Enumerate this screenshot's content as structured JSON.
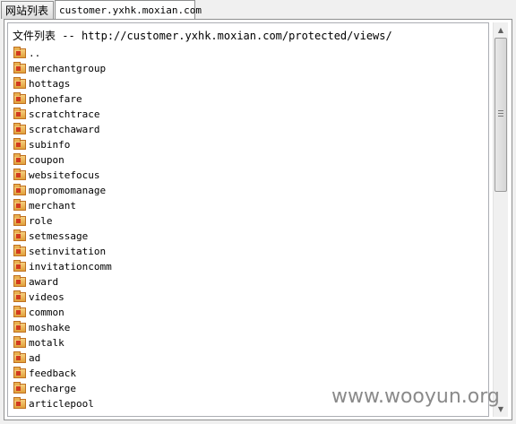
{
  "tabs": [
    {
      "label": "网站列表"
    },
    {
      "label": "customer.yxhk.moxian.com"
    }
  ],
  "header": {
    "label": "文件列表",
    "separator": "--",
    "path": "http://customer.yxhk.moxian.com/protected/views/"
  },
  "folders": [
    "..",
    "merchantgroup",
    "hottags",
    "phonefare",
    "scratchtrace",
    "scratchaward",
    "subinfo",
    "coupon",
    "websitefocus",
    "mopromomanage",
    "merchant",
    "role",
    "setmessage",
    "setinvitation",
    "invitationcomm",
    "award",
    "videos",
    "common",
    "moshake",
    "motalk",
    "ad",
    "feedback",
    "recharge",
    "articlepool"
  ],
  "icons": {
    "folder": "folder-icon",
    "scroll_up": "scroll-up-arrow-icon",
    "scroll_down": "scroll-down-arrow-icon"
  },
  "watermark": "www.wooyun.org"
}
